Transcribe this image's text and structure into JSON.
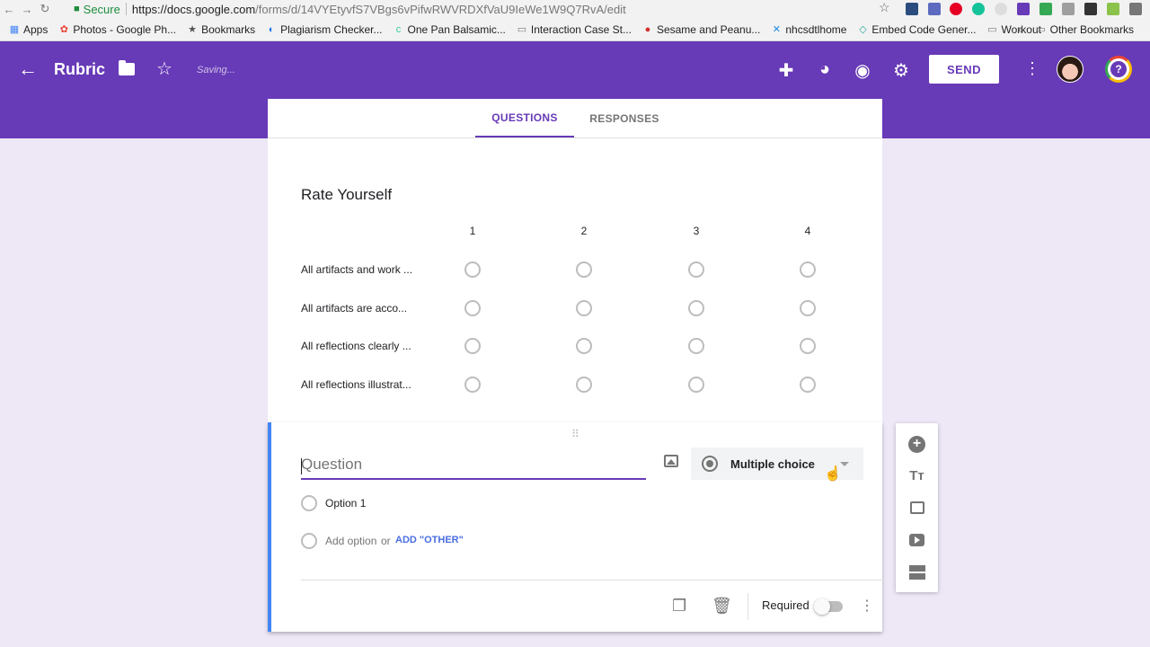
{
  "browser": {
    "secure_label": "Secure",
    "url_host": "https://docs.google.com",
    "url_path": "/forms/d/14VYEtyvfS7VBgs6vPifwRWVRDXfVaU9IeWe1W9Q7RvA/edit",
    "bookmarks": [
      {
        "label": "Apps",
        "icon": "apps-grid-icon"
      },
      {
        "label": "Photos - Google Ph...",
        "icon": "photos-icon"
      },
      {
        "label": "Bookmarks",
        "icon": "star-icon"
      },
      {
        "label": "Plagiarism Checker...",
        "icon": "plagiarism-icon"
      },
      {
        "label": "One Pan Balsamic...",
        "icon": "cc-icon"
      },
      {
        "label": "Interaction Case St...",
        "icon": "folder-icon"
      },
      {
        "label": "Sesame and Peanu...",
        "icon": "food-icon"
      },
      {
        "label": "nhcsdtlhome",
        "icon": "site-icon"
      },
      {
        "label": "Embed Code Gener...",
        "icon": "embed-icon"
      },
      {
        "label": "Workout",
        "icon": "folder-icon"
      }
    ],
    "overflow_label": "»",
    "other_bookmarks": "Other Bookmarks"
  },
  "header": {
    "title": "Rubric",
    "saving": "Saving...",
    "send_label": "SEND",
    "help_label": "?"
  },
  "tabs": {
    "questions": "QUESTIONS",
    "responses": "RESPONSES"
  },
  "grid_question": {
    "title": "Rate Yourself",
    "columns": [
      "1",
      "2",
      "3",
      "4"
    ],
    "rows": [
      "All artifacts and work ...",
      "All artifacts are acco...",
      "All reflections clearly ...",
      "All reflections illustrat..."
    ]
  },
  "active_question": {
    "placeholder": "Question",
    "type": "Multiple choice",
    "option_1": "Option 1",
    "add_option": "Add option",
    "or": "or",
    "add_other": "ADD \"OTHER\"",
    "required_label": "Required"
  },
  "colors": {
    "theme": "#673ab7",
    "background": "#ede7f6",
    "active_card_accent": "#4285f4"
  }
}
